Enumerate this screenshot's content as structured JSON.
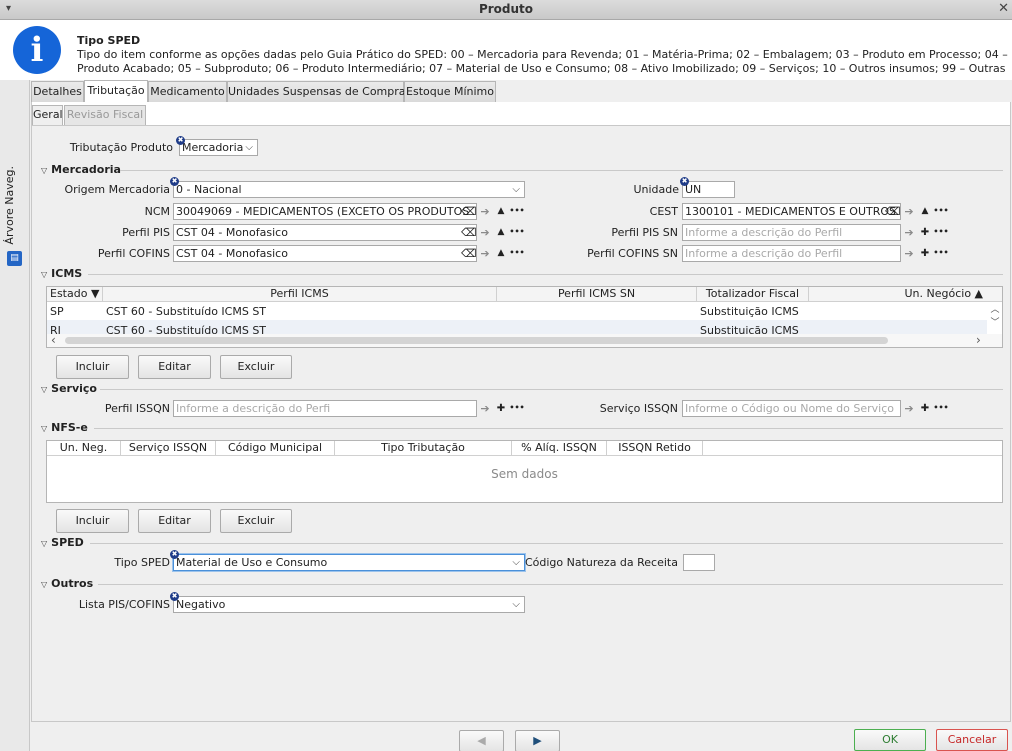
{
  "window": {
    "title": "Produto",
    "menu_glyph": "▾",
    "close_glyph": "✕"
  },
  "info": {
    "icon": "info-icon",
    "icon_glyph": "i",
    "title": "Tipo SPED",
    "description": "Tipo do item conforme as opções dadas pelo Guia Prático do SPED: 00 – Mercadoria para Revenda; 01 – Matéria-Prima; 02 – Embalagem; 03 – Produto em Processo; 04 – Produto Acabado; 05 – Subproduto; 06 – Produto Intermediário; 07 – Material de Uso e Consumo; 08 – Ativo Imobilizado; 09 – Serviços; 10 – Outros insumos; 99 – Outras"
  },
  "side": {
    "label": "Árvore Naveg.",
    "icon": "tree-icon"
  },
  "tabs": [
    "Detalhes",
    "Tributação",
    "Medicamento",
    "Unidades Suspensas de Compra",
    "Estoque Mínimo"
  ],
  "subtabs": [
    "Geral",
    "Revisão Fiscal"
  ],
  "geral": {
    "tributacao_label": "Tributação Produto",
    "tributacao_value": "Mercadoria"
  },
  "mercadoria": {
    "title": "Mercadoria",
    "origem_label": "Origem Mercadoria",
    "origem_value": "0 - Nacional",
    "unidade_label": "Unidade",
    "unidade_value": "UN",
    "ncm_label": "NCM",
    "ncm_value": "30049069 - MEDICAMENTOS (EXCETO OS PRODUTOS",
    "cest_label": "CEST",
    "cest_value": "1300101 - MEDICAMENTOS E OUTROS",
    "pis_label": "Perfil PIS",
    "pis_value": "CST 04 - Monofasico",
    "pis_sn_label": "Perfil PIS SN",
    "pis_sn_placeholder": "Informe a descrição do Perfil",
    "cofins_label": "Perfil COFINS",
    "cofins_value": "CST 04 - Monofasico",
    "cofins_sn_label": "Perfil COFINS SN",
    "cofins_sn_placeholder": "Informe a descrição do Perfil"
  },
  "icms": {
    "title": "ICMS",
    "columns": [
      "Estado ▼",
      "Perfil ICMS",
      "Perfil ICMS SN",
      "Totalizador Fiscal",
      "Un. Negócio ▲"
    ],
    "rows": [
      {
        "estado": "SP",
        "perfil": "CST 60 - Substituído ICMS ST",
        "sn": "",
        "totalizador": "Substituição ICMS",
        "un": ""
      },
      {
        "estado": "RJ",
        "perfil": "CST 60 - Substituído ICMS ST",
        "sn": "",
        "totalizador": "Substituição ICMS",
        "un": ""
      }
    ],
    "buttons": [
      "Incluir",
      "Editar",
      "Excluir"
    ]
  },
  "servico": {
    "title": "Serviço",
    "issqn_label": "Perfil ISSQN",
    "issqn_placeholder": "Informe a descrição do Perfi",
    "servico_label": "Serviço ISSQN",
    "servico_placeholder": "Informe o Código ou Nome do Serviço"
  },
  "nfse": {
    "title": "NFS-e",
    "columns": [
      "Un. Neg.",
      "Serviço ISSQN",
      "Código Municipal",
      "Tipo Tributação",
      "% Alíq. ISSQN",
      "ISSQN Retido"
    ],
    "empty": "Sem dados",
    "buttons": [
      "Incluir",
      "Editar",
      "Excluir"
    ]
  },
  "sped": {
    "title": "SPED",
    "tipo_label": "Tipo SPED",
    "tipo_value": "Material de Uso e Consumo",
    "natureza_label": "Código Natureza da Receita",
    "natureza_value": ""
  },
  "outros": {
    "title": "Outros",
    "lista_label": "Lista PIS/COFINS",
    "lista_value": "Negativo"
  },
  "footer": {
    "ok": "OK",
    "cancel": "Cancelar",
    "prev_glyph": "◀",
    "next_glyph": "▶"
  },
  "glyphs": {
    "arrow": "⌵",
    "clear": "⌫",
    "go": "➔",
    "up": "▲",
    "more": "•••",
    "plus": "✚",
    "req": "✖",
    "caret": "▽",
    "left": "‹",
    "right": "›",
    "scroll_up": "︿",
    "scroll_down": "﹀"
  }
}
